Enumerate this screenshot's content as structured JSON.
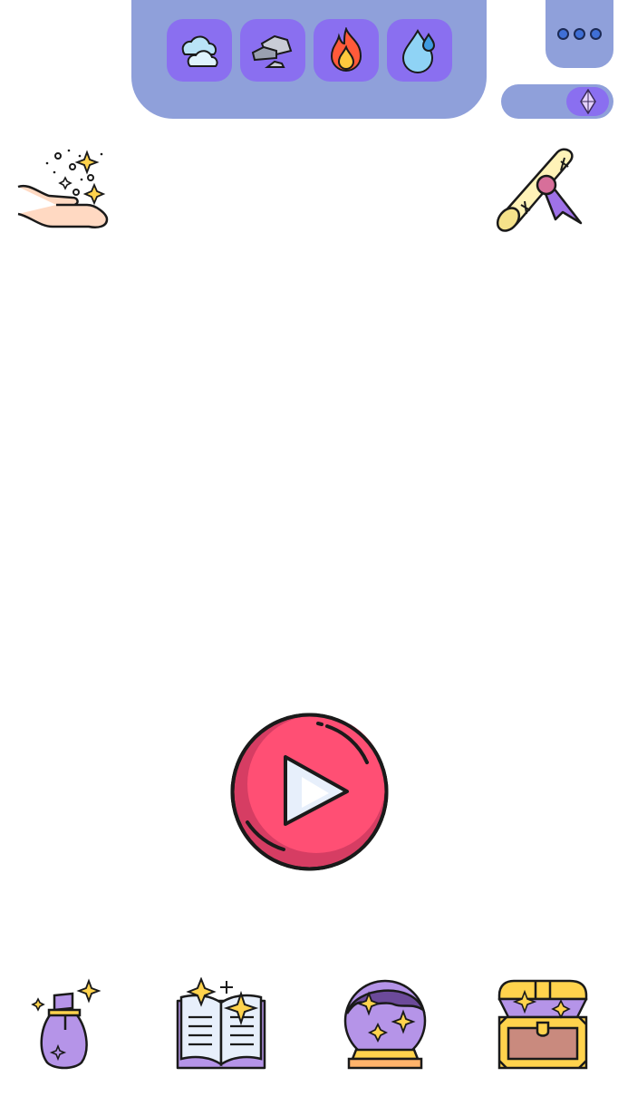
{
  "header": {
    "elements": [
      {
        "id": "air",
        "icon": "cloud-icon"
      },
      {
        "id": "earth",
        "icon": "rock-icon"
      },
      {
        "id": "fire",
        "icon": "fire-icon"
      },
      {
        "id": "water",
        "icon": "water-drop-icon"
      }
    ],
    "menu_icon": "more-dots-icon",
    "crystal_icon": "crystal-icon"
  },
  "corners": {
    "left_icon": "magic-hand-icon",
    "right_icon": "scroll-icon"
  },
  "main": {
    "play_icon": "play-icon"
  },
  "bottom_bar": {
    "items": [
      {
        "icon": "magic-bag-icon"
      },
      {
        "icon": "spell-book-icon"
      },
      {
        "icon": "crystal-ball-icon"
      },
      {
        "icon": "treasure-chest-icon"
      }
    ]
  },
  "colors": {
    "panel": "#8fa0da",
    "button": "#8a6ff0",
    "play": "#ff4f74",
    "play_dark": "#d63d63",
    "purple": "#b594e8",
    "outline": "#1a1a1a"
  }
}
